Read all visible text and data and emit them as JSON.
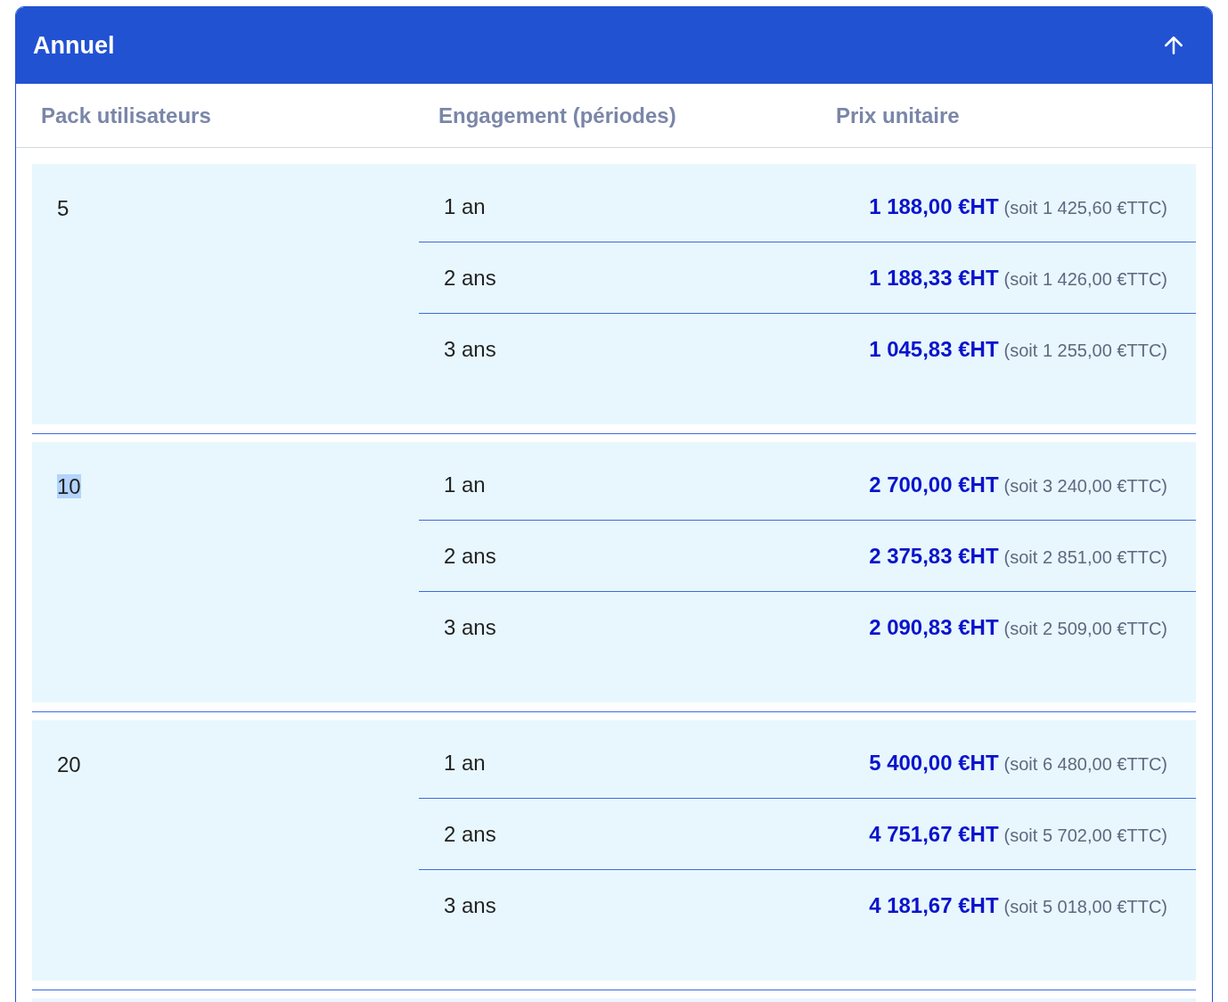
{
  "panel": {
    "title": "Annuel",
    "expanded": true
  },
  "columns": [
    "Pack utilisateurs",
    "Engagement (périodes)",
    "Prix unitaire"
  ],
  "packs": [
    {
      "users": "5",
      "highlighted": false,
      "rows": [
        {
          "engagement": "1 an",
          "price_ht": "1 188,00 €HT",
          "price_ttc": "(soit 1 425,60 €TTC)"
        },
        {
          "engagement": "2 ans",
          "price_ht": "1 188,33 €HT",
          "price_ttc": "(soit 1 426,00 €TTC)"
        },
        {
          "engagement": "3 ans",
          "price_ht": "1 045,83 €HT",
          "price_ttc": "(soit 1 255,00 €TTC)"
        }
      ]
    },
    {
      "users": "10",
      "highlighted": true,
      "rows": [
        {
          "engagement": "1 an",
          "price_ht": "2 700,00 €HT",
          "price_ttc": "(soit 3 240,00 €TTC)"
        },
        {
          "engagement": "2 ans",
          "price_ht": "2 375,83 €HT",
          "price_ttc": "(soit 2 851,00 €TTC)"
        },
        {
          "engagement": "3 ans",
          "price_ht": "2 090,83 €HT",
          "price_ttc": "(soit 2 509,00 €TTC)"
        }
      ]
    },
    {
      "users": "20",
      "highlighted": false,
      "rows": [
        {
          "engagement": "1 an",
          "price_ht": "5 400,00 €HT",
          "price_ttc": "(soit 6 480,00 €TTC)"
        },
        {
          "engagement": "2 ans",
          "price_ht": "4 751,67 €HT",
          "price_ttc": "(soit 5 702,00 €TTC)"
        },
        {
          "engagement": "3 ans",
          "price_ht": "4 181,67 €HT",
          "price_ttc": "(soit 5 018,00 €TTC)"
        }
      ]
    }
  ]
}
